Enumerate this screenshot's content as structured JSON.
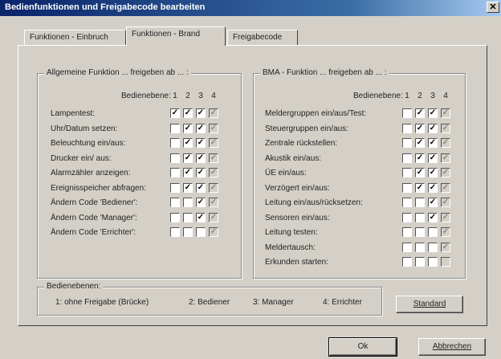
{
  "window": {
    "title": "Bedienfunktionen und Freigabecode bearbeiten",
    "close_label": "✕"
  },
  "tabs": [
    {
      "label": "Funktionen - Einbruch",
      "active": false
    },
    {
      "label": "Funktionen - Brand",
      "active": true
    },
    {
      "label": "Freigabecode",
      "active": false
    }
  ],
  "left_group": {
    "title": "Allgemeine Funktion ... freigeben ab ... :",
    "level_label": "Bedienebene:",
    "levels": [
      "1",
      "2",
      "3",
      "4"
    ],
    "rows": [
      {
        "label": "Lampentest:",
        "checks": [
          true,
          true,
          true,
          true
        ],
        "disabled": [
          false,
          false,
          false,
          true
        ]
      },
      {
        "label": "Uhr/Datum setzen:",
        "checks": [
          false,
          true,
          true,
          true
        ],
        "disabled": [
          false,
          false,
          false,
          true
        ]
      },
      {
        "label": "Beleuchtung ein/aus:",
        "checks": [
          false,
          true,
          true,
          true
        ],
        "disabled": [
          false,
          false,
          false,
          true
        ]
      },
      {
        "label": "Drucker ein/ aus:",
        "checks": [
          false,
          true,
          true,
          true
        ],
        "disabled": [
          false,
          false,
          false,
          true
        ]
      },
      {
        "label": "Alarmzähler anzeigen:",
        "checks": [
          false,
          true,
          true,
          true
        ],
        "disabled": [
          false,
          false,
          false,
          true
        ]
      },
      {
        "label": "Ereignisspeicher abfragen:",
        "checks": [
          false,
          true,
          true,
          true
        ],
        "disabled": [
          false,
          false,
          false,
          true
        ]
      },
      {
        "label": "Ändern Code 'Bediener':",
        "checks": [
          false,
          false,
          true,
          true
        ],
        "disabled": [
          false,
          false,
          false,
          true
        ]
      },
      {
        "label": "Ändern Code 'Manager':",
        "checks": [
          false,
          false,
          true,
          true
        ],
        "disabled": [
          false,
          false,
          false,
          true
        ]
      },
      {
        "label": "Ändern Code 'Errichter':",
        "checks": [
          false,
          false,
          false,
          true
        ],
        "disabled": [
          false,
          false,
          false,
          true
        ]
      }
    ]
  },
  "right_group": {
    "title": "BMA - Funktion ... freigeben ab ... :",
    "level_label": "Bedienebene:",
    "levels": [
      "1",
      "2",
      "3",
      "4"
    ],
    "rows": [
      {
        "label": "Meldergruppen ein/aus/Test:",
        "checks": [
          false,
          true,
          true,
          true
        ],
        "disabled": [
          false,
          false,
          false,
          true
        ]
      },
      {
        "label": "Steuergruppen ein/aus:",
        "checks": [
          false,
          true,
          true,
          true
        ],
        "disabled": [
          false,
          false,
          false,
          true
        ]
      },
      {
        "label": "Zentrale rückstellen:",
        "checks": [
          false,
          true,
          true,
          true
        ],
        "disabled": [
          false,
          false,
          false,
          true
        ]
      },
      {
        "label": "Akustik ein/aus:",
        "checks": [
          false,
          true,
          true,
          true
        ],
        "disabled": [
          false,
          false,
          false,
          true
        ]
      },
      {
        "label": "ÜE ein/aus:",
        "checks": [
          false,
          true,
          true,
          true
        ],
        "disabled": [
          false,
          false,
          false,
          true
        ]
      },
      {
        "label": "Verzögert ein/aus:",
        "checks": [
          false,
          true,
          true,
          true
        ],
        "disabled": [
          false,
          false,
          false,
          true
        ]
      },
      {
        "label": "Leitung ein/aus/rücksetzen:",
        "checks": [
          false,
          false,
          true,
          true
        ],
        "disabled": [
          false,
          false,
          false,
          true
        ]
      },
      {
        "label": "Sensoren ein/aus:",
        "checks": [
          false,
          false,
          true,
          true
        ],
        "disabled": [
          false,
          false,
          false,
          true
        ]
      },
      {
        "label": "Leitung testen:",
        "checks": [
          false,
          false,
          false,
          true
        ],
        "disabled": [
          false,
          false,
          false,
          true
        ]
      },
      {
        "label": "Meldertausch:",
        "checks": [
          false,
          false,
          false,
          true
        ],
        "disabled": [
          false,
          false,
          false,
          true
        ]
      },
      {
        "label": "Erkunden starten:",
        "checks": [
          false,
          false,
          false,
          false
        ],
        "disabled": [
          false,
          false,
          false,
          true
        ]
      }
    ]
  },
  "levels_group": {
    "title": "Bedienebenen:",
    "items": [
      "1: ohne Freigabe (Brücke)",
      "2: Bediener",
      "3: Manager",
      "4: Errichter"
    ]
  },
  "buttons": {
    "standard": "Standard",
    "ok": "Ok",
    "cancel": "Abbrechen"
  }
}
